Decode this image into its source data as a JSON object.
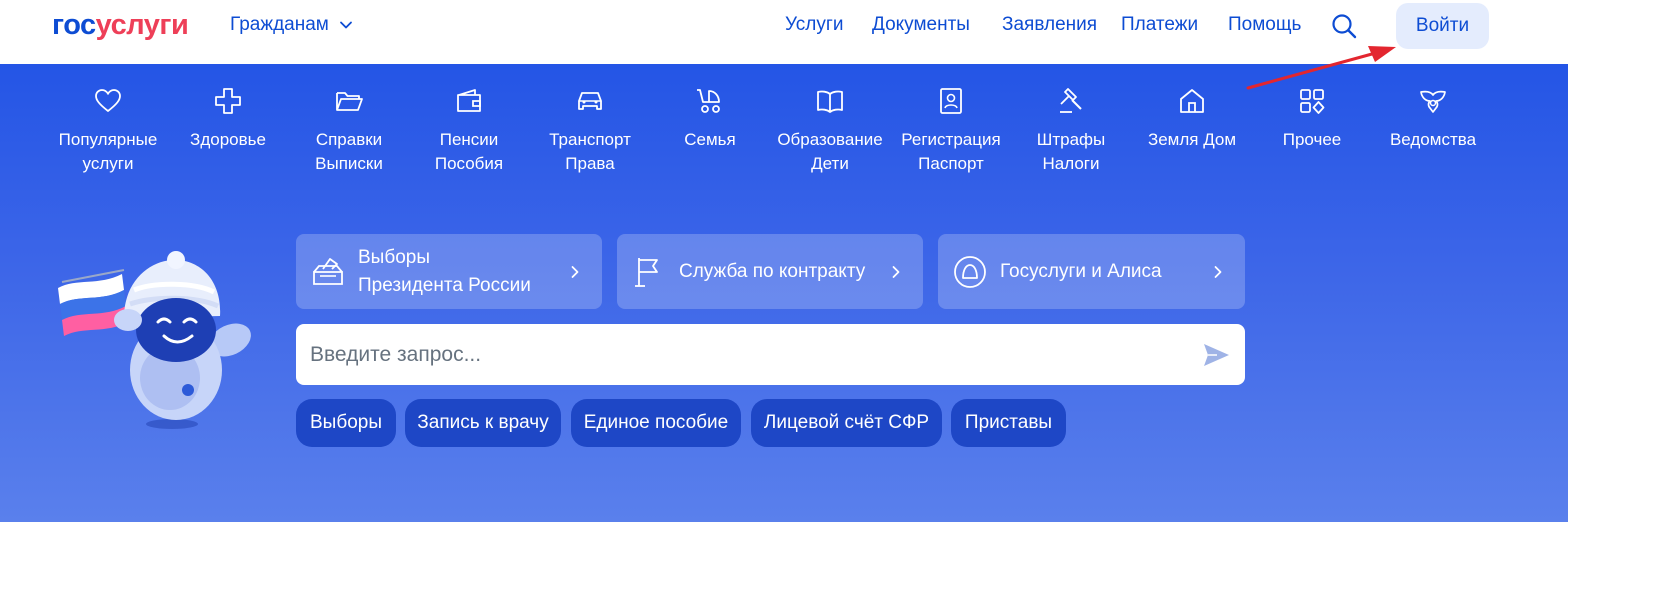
{
  "header": {
    "logo_part1": "гос",
    "logo_part2": "услуги",
    "audience": "Гражданам",
    "nav": [
      "Услуги",
      "Документы",
      "Заявления",
      "Платежи",
      "Помощь"
    ],
    "login": "Войти"
  },
  "categories": [
    {
      "line1": "Популярные",
      "line2": "услуги",
      "icon": "heart-icon"
    },
    {
      "line1": "Здоровье",
      "line2": "",
      "icon": "health-cross-icon"
    },
    {
      "line1": "Справки",
      "line2": "Выписки",
      "icon": "folder-icon"
    },
    {
      "line1": "Пенсии",
      "line2": "Пособия",
      "icon": "wallet-icon"
    },
    {
      "line1": "Транспорт",
      "line2": "Права",
      "icon": "car-icon"
    },
    {
      "line1": "Семья",
      "line2": "",
      "icon": "stroller-icon"
    },
    {
      "line1": "Образование",
      "line2": "Дети",
      "icon": "book-icon"
    },
    {
      "line1": "Регистрация",
      "line2": "Паспорт",
      "icon": "passport-icon"
    },
    {
      "line1": "Штрафы",
      "line2": "Налоги",
      "icon": "gavel-icon"
    },
    {
      "line1": "Земля Дом",
      "line2": "",
      "icon": "house-icon"
    },
    {
      "line1": "Прочее",
      "line2": "",
      "icon": "grid-icon"
    },
    {
      "line1": "Ведомства",
      "line2": "",
      "icon": "eagle-icon"
    }
  ],
  "promos": [
    {
      "line1": "Выборы",
      "line2": "Президента России",
      "icon": "ballot-box-icon"
    },
    {
      "line1": "Служба по контракту",
      "line2": "",
      "icon": "flag-icon"
    },
    {
      "line1": "Госуслуги и Алиса",
      "line2": "",
      "icon": "alice-icon"
    }
  ],
  "search": {
    "placeholder": "Введите запрос..."
  },
  "quick_links": [
    "Выборы",
    "Запись к врачу",
    "Единое пособие",
    "Лицевой счёт СФР",
    "Приставы"
  ],
  "colors": {
    "brand_blue": "#0d4cd3",
    "brand_red": "#ee3f58",
    "hero_blue": "#2455e6",
    "annotation_red": "#e3262f"
  }
}
